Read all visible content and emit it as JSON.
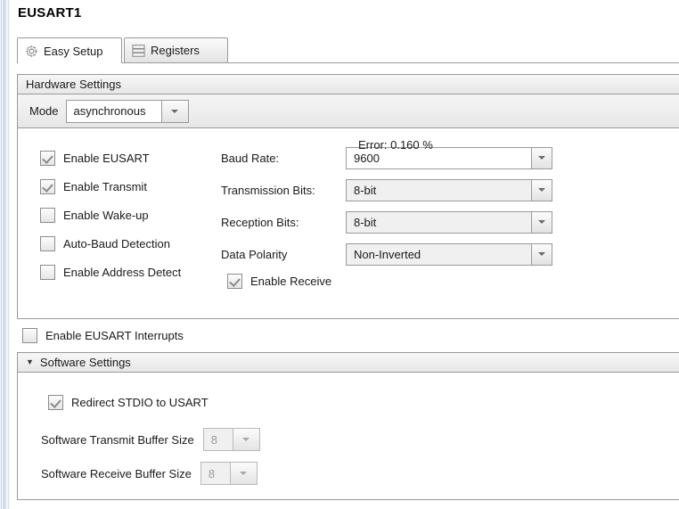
{
  "window": {
    "title": "EUSART1"
  },
  "tabs": [
    {
      "id": "easy-setup",
      "label": "Easy Setup",
      "icon": "gear-icon",
      "selected": true
    },
    {
      "id": "registers",
      "label": "Registers",
      "icon": "registers-icon",
      "selected": false
    }
  ],
  "hardware": {
    "header": "Hardware Settings",
    "mode": {
      "label": "Mode",
      "value": "asynchronous",
      "arrow": "▾"
    },
    "checkboxes": [
      {
        "label": "Enable EUSART",
        "checked": true,
        "disabled": true
      },
      {
        "label": "Enable Transmit",
        "checked": true,
        "disabled": true
      },
      {
        "label": "Enable Wake-up",
        "checked": false,
        "disabled": false
      },
      {
        "label": "Auto-Baud Detection",
        "checked": false,
        "disabled": false
      },
      {
        "label": "Enable Address Detect",
        "checked": false,
        "disabled": false
      }
    ],
    "fields": [
      {
        "label": "Baud Rate:",
        "value": "9600",
        "style": "editable"
      },
      {
        "label": "Transmission Bits:",
        "value": "8-bit",
        "style": "dropdown"
      },
      {
        "label": "Reception Bits:",
        "value": "8-bit",
        "style": "dropdown"
      },
      {
        "label": "Data Polarity",
        "value": "Non-Inverted",
        "style": "dropdown"
      }
    ],
    "enable_receive": {
      "label": "Enable Receive",
      "checked": true,
      "disabled": true
    },
    "error_text": "Error: 0.160 %"
  },
  "interrupts": {
    "label": "Enable EUSART Interrupts",
    "checked": false
  },
  "software": {
    "header": "Software Settings",
    "collapse_glyph": "▼",
    "redirect": {
      "label": "Redirect STDIO to USART",
      "checked": true,
      "disabled": true
    },
    "transmit_buffer": {
      "label": "Software Transmit Buffer Size",
      "value": "8",
      "disabled": true
    },
    "receive_buffer": {
      "label": "Software Receive Buffer Size",
      "value": "8",
      "disabled": true
    }
  },
  "colors": {
    "border": "#9a9a9a",
    "header_bg": "#eeeeee",
    "panel_bg": "#ffffff",
    "disabled_text": "#9b9b9b",
    "edge_blue": "#b6cfe0"
  }
}
